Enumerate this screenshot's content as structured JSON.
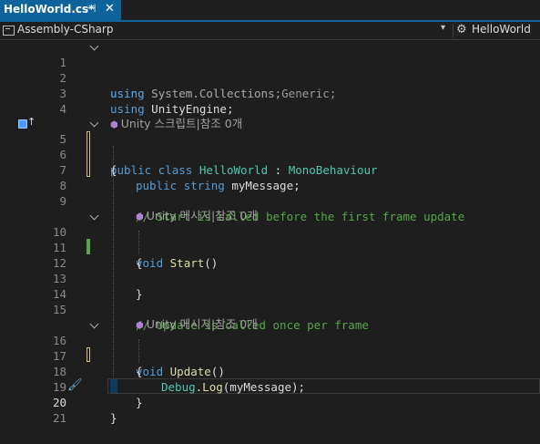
{
  "tab": {
    "title": "HelloWorld.cs*",
    "pin_glyph": "⊣",
    "close_glyph": "✕"
  },
  "navbar": {
    "project": "Assembly-CSharp",
    "dropdown_glyph": "▾",
    "class_icon": "⚙",
    "class": "HelloWorld"
  },
  "editor": {
    "line_numbers": [
      "1",
      "2",
      "3",
      "4",
      "5",
      "6",
      "7",
      "8",
      "9",
      "10",
      "11",
      "12",
      "13",
      "14",
      "15",
      "16",
      "17",
      "18",
      "19",
      "20",
      "21"
    ],
    "code": {
      "l1_kw": "using",
      "l1_rest": " System.Collections;",
      "l2_kw": "using",
      "l2_rest": " System.Collections.Generic;",
      "l3_kw": "using",
      "l3_rest": " UnityEngine;",
      "lens_class": "Unity 스크립트|참조 0개",
      "l5_kw": "public class",
      "l5_name": "HelloWorld",
      "l5_colon": " : ",
      "l5_base": "MonoBehaviour",
      "l6": "{",
      "l7_kw": "public string",
      "l7_rest": " myMessage;",
      "l9_comment": "// Start is called before the first frame update",
      "lens_start": "Unity 메시지|참조 0개",
      "l10_kw": "void",
      "l10_fn": "Start",
      "l10_paren": "()",
      "l11": "{",
      "l13": "}",
      "l15_comment": "// Update is called once per frame",
      "lens_update": "Unity 메시지|참조 0개",
      "l16_kw": "void",
      "l16_fn": "Update",
      "l16_paren": "()",
      "l17": "{",
      "l18_obj": "Debug",
      "l18_dot": ".",
      "l18_fn": "Log",
      "l18_rest": "(myMessage);",
      "l19": "}",
      "l20": "}"
    }
  },
  "colors": {
    "keyword": "#569cd6",
    "type": "#4ec9b0",
    "method": "#dcdcaa",
    "comment": "#57a64a",
    "accent": "#0e639c"
  },
  "icons": [
    "pin-icon",
    "close-icon",
    "project-icon",
    "class-icon",
    "breakpoint-icon",
    "brush-icon",
    "fold-icon"
  ]
}
